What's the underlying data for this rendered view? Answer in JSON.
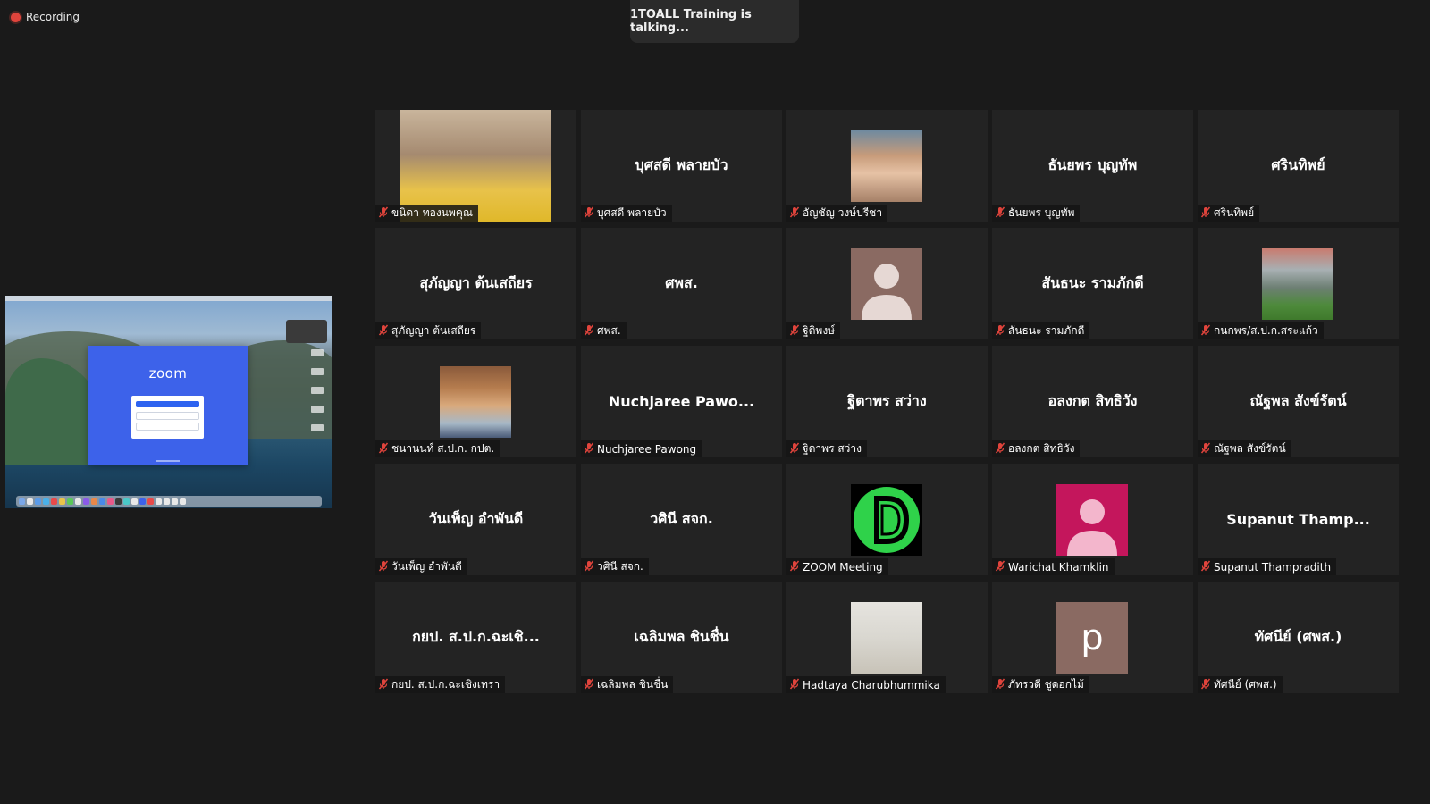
{
  "recording": {
    "label": "Recording",
    "color": "#e0443c"
  },
  "speaker_banner": "1TOALL Training is talking...",
  "share_screen": {
    "app_logo": "zoom"
  },
  "participants": [
    {
      "display": "",
      "name": "ขนิดา ทองนพคุณ",
      "avatar": "photo-woman",
      "muted": true
    },
    {
      "display": "บุศสดี พลายบัว",
      "name": "บุศสดี พลายบัว",
      "avatar": "none",
      "muted": true
    },
    {
      "display": "",
      "name": "อัญชัญ วงษ์ปรีชา",
      "avatar": "photo-woman2",
      "muted": true
    },
    {
      "display": "ธันยพร บุญทัพ",
      "name": "ธันยพร บุญทัพ",
      "avatar": "none",
      "muted": true
    },
    {
      "display": "ศรินทิพย์",
      "name": "ศรินทิพย์",
      "avatar": "none",
      "muted": true
    },
    {
      "display": "สุภัญญา ต้นเสถียร",
      "name": "สุภัญญา ต้นเสถียร",
      "avatar": "none",
      "muted": true
    },
    {
      "display": "ศพส.",
      "name": "ศพส.",
      "avatar": "none",
      "muted": true
    },
    {
      "display": "",
      "name": "ฐิติพงษ์",
      "avatar": "person-icon",
      "muted": true
    },
    {
      "display": "สันธนะ รามภักดี",
      "name": "สันธนะ รามภักดี",
      "avatar": "none",
      "muted": true
    },
    {
      "display": "",
      "name": "กนกพร/ส.ป.ก.สระแก้ว",
      "avatar": "photo-landscape",
      "muted": true
    },
    {
      "display": "",
      "name": "ชนานนท์ ส.ป.ก. กปต.",
      "avatar": "photo-man",
      "muted": true
    },
    {
      "display": "Nuchjaree  Pawo...",
      "name": "Nuchjaree Pawong",
      "avatar": "none",
      "muted": true
    },
    {
      "display": "ฐิตาพร สว่าง",
      "name": "ฐิตาพร สว่าง",
      "avatar": "none",
      "muted": true
    },
    {
      "display": "อลงกต สิทธิวัง",
      "name": "อลงกต สิทธิวัง",
      "avatar": "none",
      "muted": true
    },
    {
      "display": "ณัฐพล สังข์รัตน์",
      "name": "ณัฐพล สังข์รัตน์",
      "avatar": "none",
      "muted": true
    },
    {
      "display": "วันเพ็ญ อำพันดี",
      "name": "วันเพ็ญ อำพันดี",
      "avatar": "none",
      "muted": true
    },
    {
      "display": "วศินี สจก.",
      "name": "วศินี สจก.",
      "avatar": "none",
      "muted": true
    },
    {
      "display": "",
      "name": "ZOOM Meeting",
      "avatar": "green-d-logo",
      "muted": true
    },
    {
      "display": "",
      "name": "Warichat Khamklin",
      "avatar": "person-icon-pink",
      "muted": true
    },
    {
      "display": "Supanut  Thamp...",
      "name": "Supanut Thampradith",
      "avatar": "none",
      "muted": true
    },
    {
      "display": "กยป. ส.ป.ก.ฉะเชิ...",
      "name": "กยป. ส.ป.ก.ฉะเชิงเทรา",
      "avatar": "none",
      "muted": true
    },
    {
      "display": "เฉลิมพล ชินชื่น",
      "name": "เฉลิมพล ชินชื่น",
      "avatar": "none",
      "muted": true
    },
    {
      "display": "",
      "name": "Hadtaya Charubhummika",
      "avatar": "photo-room",
      "muted": true
    },
    {
      "display": "",
      "name": "ภัทรวดี ชูดอกไม้",
      "avatar": "letter-p",
      "avatar_letter": "p",
      "muted": true
    },
    {
      "display": "ทัศนีย์ (ศพส.)",
      "name": "ทัศนีย์ (ศพส.)",
      "avatar": "none",
      "muted": true
    }
  ]
}
